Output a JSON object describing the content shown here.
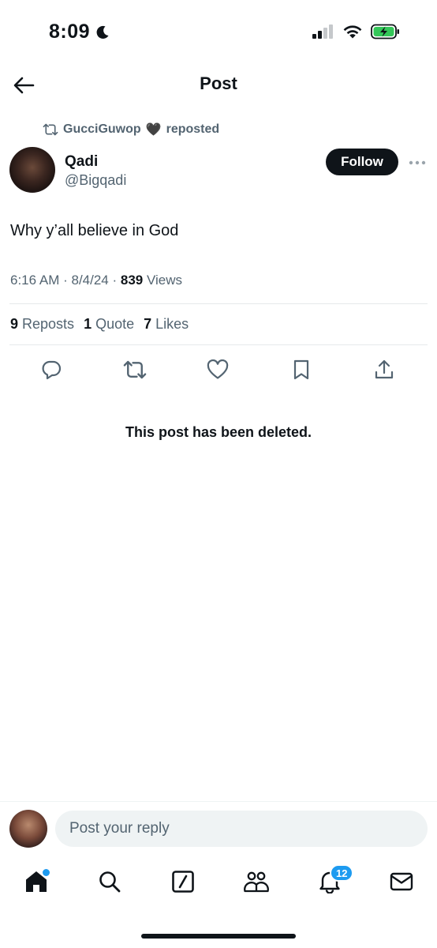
{
  "status_bar": {
    "time": "8:09",
    "icons": [
      "moon-icon",
      "cellular-signal-icon",
      "wifi-icon",
      "battery-charging-icon"
    ],
    "battery_color": "#34c759"
  },
  "header": {
    "title": "Post",
    "back_icon": "arrow-left-icon"
  },
  "repost": {
    "icon": "repost-icon",
    "user": "GucciGuwop",
    "emoji": "🖤",
    "label": "reposted"
  },
  "author": {
    "name": "Qadi",
    "handle": "@Bigqadi",
    "follow_label": "Follow",
    "more_icon": "more-horizontal-icon"
  },
  "post": {
    "text": "Why y’all believe in God",
    "time": "6:16 AM",
    "sep1": " · ",
    "date": "8/4/24",
    "sep2": " · ",
    "views_count": "839",
    "views_label": " Views"
  },
  "stats": [
    {
      "count": "9",
      "label": " Reposts"
    },
    {
      "count": "1",
      "label": " Quote"
    },
    {
      "count": "7",
      "label": " Likes"
    }
  ],
  "actions": [
    "reply-icon",
    "repost-icon",
    "like-icon",
    "bookmark-icon",
    "share-icon"
  ],
  "deleted_notice": "This post has been deleted.",
  "reply": {
    "placeholder": "Post your reply"
  },
  "tabbar": {
    "items": [
      "home-icon",
      "search-icon",
      "grok-icon",
      "communities-icon",
      "notifications-icon",
      "messages-icon"
    ],
    "notifications_badge": "12",
    "accent": "#1d9bf0"
  },
  "colors": {
    "text_primary": "#0f1419",
    "text_secondary": "#536471",
    "accent": "#1d9bf0"
  }
}
